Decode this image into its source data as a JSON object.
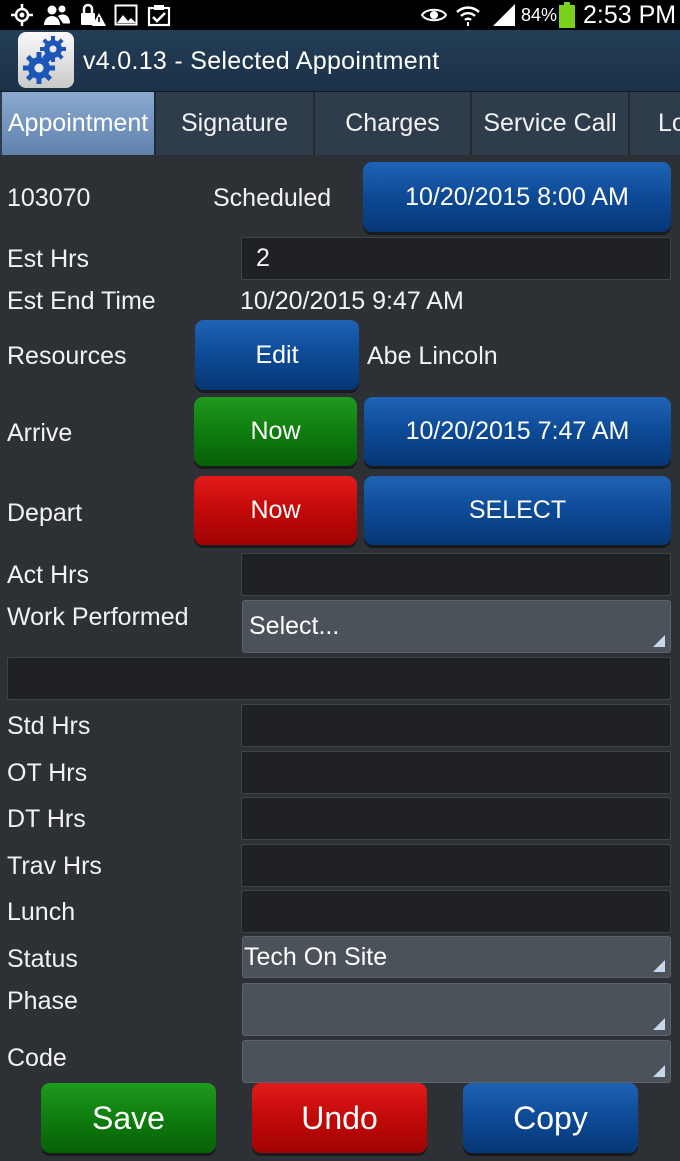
{
  "status_bar": {
    "icons": [
      "gps-icon",
      "people-icon",
      "lock-warning-icon",
      "image-icon",
      "clipboard-check-icon",
      "eye-icon",
      "wifi-icon",
      "signal-icon",
      "battery-icon"
    ],
    "battery": "84%",
    "time": "2:53 PM"
  },
  "app": {
    "title": "v4.0.13 - Selected Appointment",
    "icon": "gears-icon"
  },
  "tabs": [
    {
      "label": "Appointment",
      "active": true
    },
    {
      "label": "Signature",
      "active": false
    },
    {
      "label": "Charges",
      "active": false
    },
    {
      "label": "Service Call",
      "active": false
    },
    {
      "label": "Lo",
      "active": false
    }
  ],
  "appointment": {
    "number": "103070",
    "status": "Scheduled",
    "datetime_button": "10/20/2015 8:00 AM"
  },
  "est_hrs": {
    "label": "Est Hrs",
    "value": "2"
  },
  "est_end": {
    "label": "Est End Time",
    "value": "10/20/2015 9:47 AM"
  },
  "resources": {
    "label": "Resources",
    "edit_button": "Edit",
    "name": "Abe Lincoln"
  },
  "arrive": {
    "label": "Arrive",
    "now_button": "Now",
    "datetime_button": "10/20/2015 7:47 AM"
  },
  "depart": {
    "label": "Depart",
    "now_button": "Now",
    "select_button": "SELECT"
  },
  "act_hrs": {
    "label": "Act Hrs",
    "value": ""
  },
  "work_performed": {
    "label": "Work Performed",
    "selected": "Select...",
    "notes": ""
  },
  "std_hrs": {
    "label": "Std Hrs",
    "value": ""
  },
  "ot_hrs": {
    "label": "OT Hrs",
    "value": ""
  },
  "dt_hrs": {
    "label": "DT Hrs",
    "value": ""
  },
  "trav_hrs": {
    "label": "Trav Hrs",
    "value": ""
  },
  "lunch": {
    "label": "Lunch",
    "value": ""
  },
  "status": {
    "label": "Status",
    "selected": "Tech On Site"
  },
  "phase": {
    "label": "Phase",
    "selected": ""
  },
  "code": {
    "label": "Code",
    "selected": ""
  },
  "footer": {
    "save": "Save",
    "undo": "Undo",
    "copy": "Copy"
  },
  "colors": {
    "green": "#0f7d0f",
    "red": "#c20909",
    "blue": "#0d4a96",
    "background": "#2d3035",
    "active_tab": "#7094c2"
  }
}
